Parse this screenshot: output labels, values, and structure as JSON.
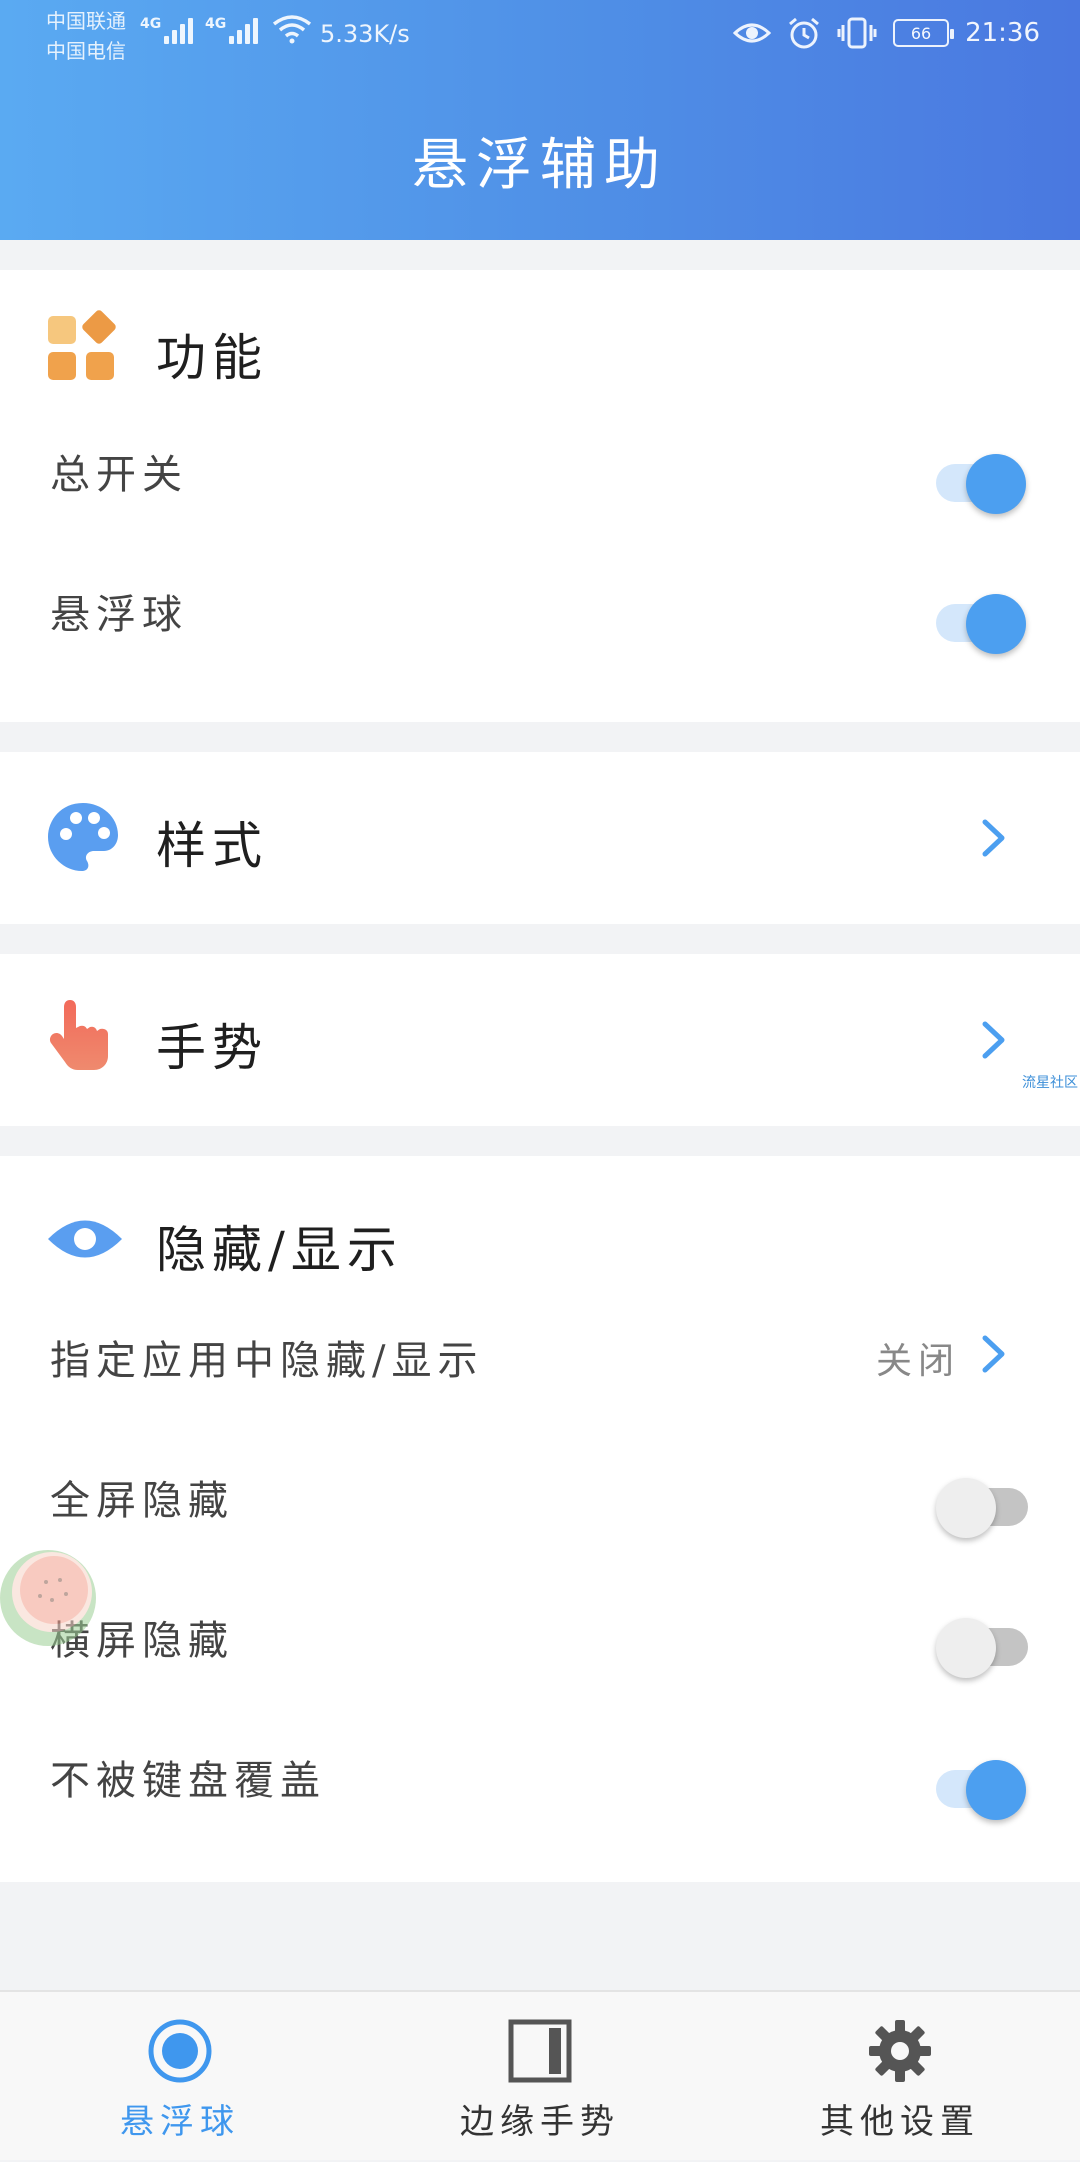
{
  "status_bar": {
    "carrier_1": "中国联通",
    "carrier_2": "中国电信",
    "network_1": "4G",
    "network_2": "4G",
    "speed": "5.33K/s",
    "battery": "66",
    "time": "21:36",
    "icons": [
      "eye-icon",
      "alarm-icon",
      "vibrate-icon"
    ]
  },
  "header": {
    "title": "悬浮辅助"
  },
  "sections": {
    "function": {
      "title": "功能",
      "icon": "apps-grid-icon",
      "rows": [
        {
          "label": "总开关",
          "toggle": true
        },
        {
          "label": "悬浮球",
          "toggle": true
        }
      ]
    },
    "style": {
      "title": "样式",
      "icon": "palette-icon"
    },
    "gesture": {
      "title": "手势",
      "icon": "pointing-hand-icon"
    },
    "hide_show": {
      "title": "隐藏/显示",
      "icon": "eye-icon",
      "app_row": {
        "label": "指定应用中隐藏/显示",
        "value": "关闭"
      },
      "rows": [
        {
          "label": "全屏隐藏",
          "toggle": false
        },
        {
          "label": "横屏隐藏",
          "toggle": false
        },
        {
          "label": "不被键盘覆盖",
          "toggle": true
        }
      ]
    }
  },
  "watermark": "流星社区",
  "bottom_nav": [
    {
      "label": "悬浮球",
      "icon": "floating-ball-icon",
      "active": true
    },
    {
      "label": "边缘手势",
      "icon": "edge-panel-icon",
      "active": false
    },
    {
      "label": "其他设置",
      "icon": "gear-icon",
      "active": false
    }
  ],
  "colors": {
    "accent": "#4c9ff0",
    "header_gradient_start": "#5aaaf2",
    "header_gradient_end": "#4a78e0",
    "toggle_off": "#c4c4c4"
  }
}
